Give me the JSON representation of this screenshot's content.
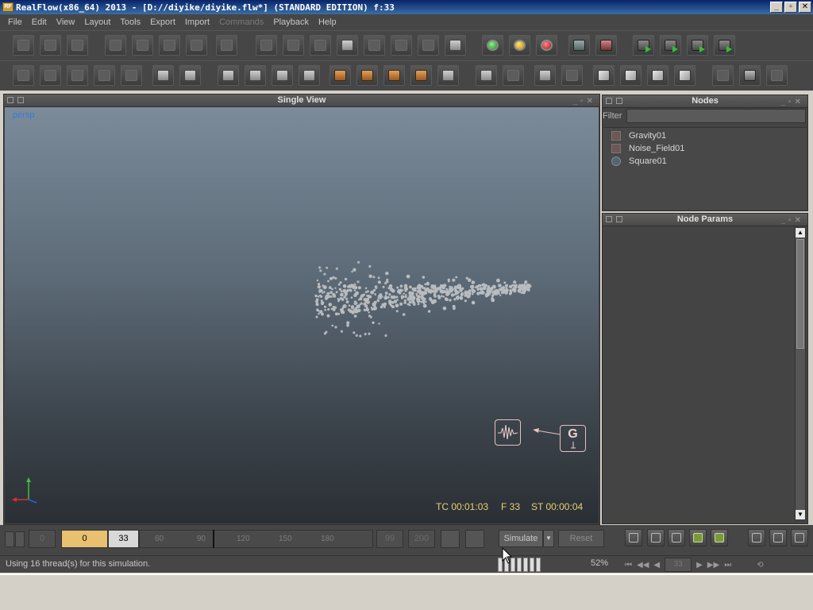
{
  "window": {
    "title": "RealFlow(x86_64) 2013 - [D://diyike/diyike.flw*] (STANDARD EDITION) f:33",
    "app_icon_text": "RF",
    "minimize": "_",
    "maximize": "▫",
    "close": "✕"
  },
  "menu": {
    "items": [
      {
        "label": "File",
        "enabled": true
      },
      {
        "label": "Edit",
        "enabled": true
      },
      {
        "label": "View",
        "enabled": true
      },
      {
        "label": "Layout",
        "enabled": true
      },
      {
        "label": "Tools",
        "enabled": true
      },
      {
        "label": "Export",
        "enabled": true
      },
      {
        "label": "Import",
        "enabled": true
      },
      {
        "label": "Commands",
        "enabled": false
      },
      {
        "label": "Playback",
        "enabled": true
      },
      {
        "label": "Help",
        "enabled": true
      }
    ]
  },
  "viewport": {
    "panel_title": "Single View",
    "camera_label": "persp",
    "timecode": "TC 00:01:03",
    "frame": "F 33",
    "sim_time": "ST 00:00:04",
    "gravity_gizmo": "G"
  },
  "nodes": {
    "panel_title": "Nodes",
    "filter_label": "Filter",
    "filter_value": "",
    "items": [
      "Gravity01",
      "Noise_Field01",
      "Square01"
    ]
  },
  "params": {
    "panel_title": "Node Params"
  },
  "timeline": {
    "min_frame": "0",
    "start_frame": "0",
    "current_frame": "33",
    "ticks": [
      "60",
      "90",
      "120",
      "150",
      "180"
    ],
    "end_a": "99",
    "end_b": "200",
    "simulate_label": "Simulate",
    "reset_label": "Reset"
  },
  "status": {
    "message": "Using 16 thread(s) for this simulation.",
    "percent": "52%",
    "frame_field": "33"
  },
  "colors": {
    "timecode": "#e8d070",
    "camera_label": "#3a7ad0",
    "start_frame_bg": "#e8c070"
  }
}
